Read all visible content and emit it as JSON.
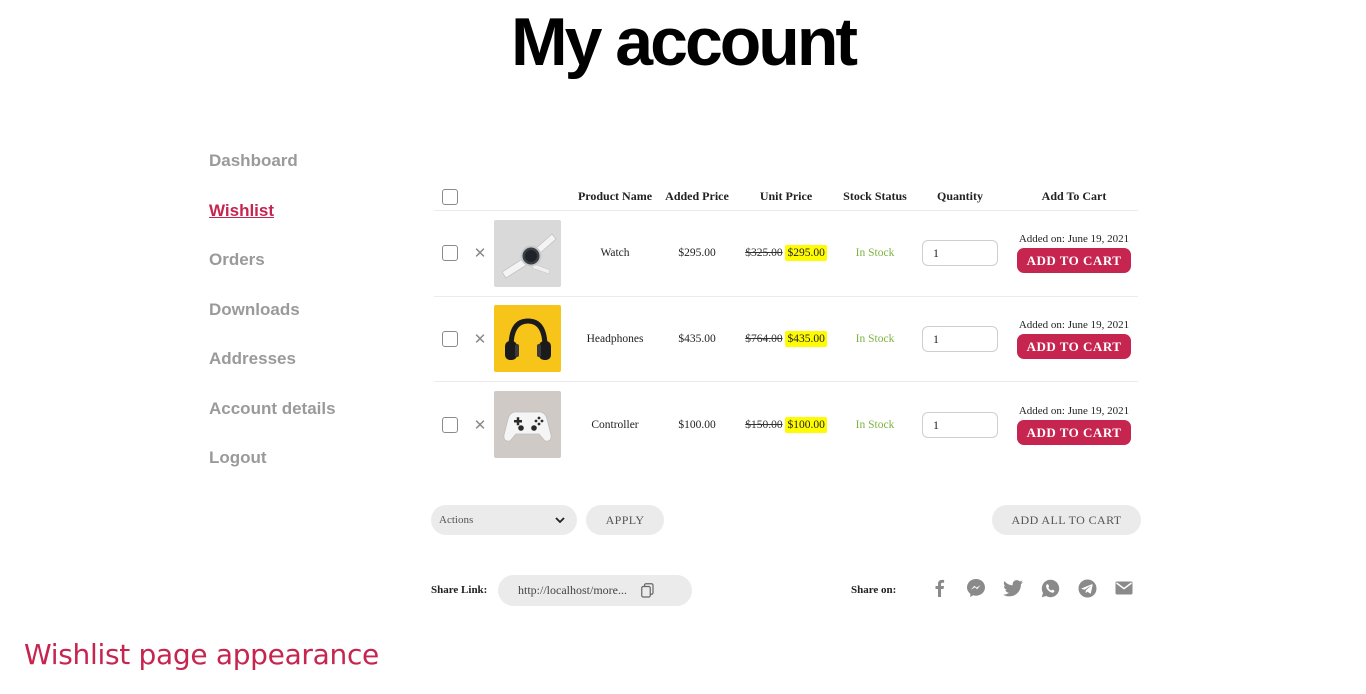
{
  "page_title": "My account",
  "nav": [
    {
      "label": "Dashboard"
    },
    {
      "label": "Wishlist"
    },
    {
      "label": "Orders"
    },
    {
      "label": "Downloads"
    },
    {
      "label": "Addresses"
    },
    {
      "label": "Account details"
    },
    {
      "label": "Logout"
    }
  ],
  "active_nav": "Wishlist",
  "table": {
    "headers": {
      "product_name": "Product Name",
      "added_price": "Added Price",
      "unit_price": "Unit Price",
      "stock_status": "Stock Status",
      "quantity": "Quantity",
      "add_to_cart": "Add To Cart"
    },
    "rows": [
      {
        "name": "Watch",
        "added_price": "$295.00",
        "old_price": "$325.00",
        "sale_price": "$295.00",
        "stock": "In Stock",
        "quantity": "1",
        "added_on": "Added on: June 19, 2021",
        "button": "ADD TO CART",
        "image": "watch-image"
      },
      {
        "name": "Headphones",
        "added_price": "$435.00",
        "old_price": "$764.00",
        "sale_price": "$435.00",
        "stock": "In Stock",
        "quantity": "1",
        "added_on": "Added on: June 19, 2021",
        "button": "ADD TO CART",
        "image": "headphones-image"
      },
      {
        "name": "Controller",
        "added_price": "$100.00",
        "old_price": "$150.00",
        "sale_price": "$100.00",
        "stock": "In Stock",
        "quantity": "1",
        "added_on": "Added on: June 19, 2021",
        "button": "ADD TO CART",
        "image": "controller-image"
      }
    ]
  },
  "bulk": {
    "actions_label": "Actions",
    "apply_label": "APPLY",
    "add_all_label": "ADD ALL TO CART"
  },
  "share": {
    "link_label": "Share Link:",
    "link_value": "http://localhost/more...",
    "on_label": "Share on:",
    "icons": [
      "facebook-icon",
      "messenger-icon",
      "twitter-icon",
      "whatsapp-icon",
      "telegram-icon",
      "email-icon"
    ]
  },
  "caption": "Wishlist page appearance",
  "colors": {
    "accent": "#c5254f",
    "in_stock": "#7cb342",
    "sale_highlight": "#fffb00",
    "muted_nav": "#9a9a9a",
    "pill_bg": "#ebebeb"
  }
}
